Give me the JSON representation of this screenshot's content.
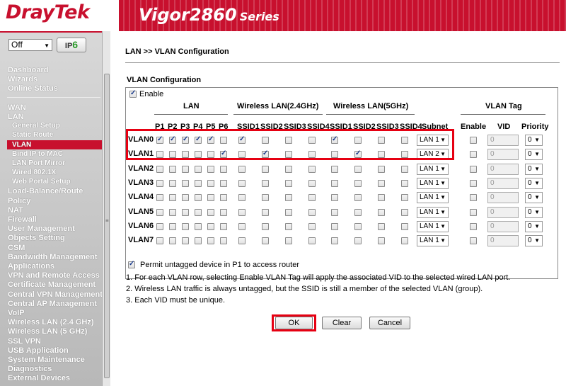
{
  "header": {
    "brand": "DrayTek",
    "model": "Vigor2860",
    "series": "Series"
  },
  "sidebar": {
    "mode_select": "Off",
    "ipv6_label": "IP",
    "ipv6_digit": "6",
    "groups": [
      [
        "Dashboard",
        "Wizards",
        "Online Status"
      ],
      [
        "WAN",
        "LAN"
      ]
    ],
    "lan_sub": [
      "General Setup",
      "Static Route",
      "VLAN",
      "Bind IP to MAC",
      "LAN Port Mirror",
      "Wired 802.1X",
      "Web Portal Setup"
    ],
    "items": [
      "Load-Balance/Route",
      "Policy",
      "NAT",
      "Firewall",
      "User Management",
      "Objects Setting",
      "CSM",
      "Bandwidth Management",
      "Applications",
      "VPN and Remote Access",
      "Certificate Management",
      "Central VPN Management",
      "Central AP Management",
      "VoIP",
      "Wireless LAN (2.4 GHz)",
      "Wireless LAN (5 GHz)",
      "SSL VPN",
      "USB Application",
      "System Maintenance",
      "Diagnostics",
      "External Devices"
    ],
    "active": "VLAN"
  },
  "main": {
    "breadcrumb": "LAN >> VLAN Configuration",
    "section_title": "VLAN Configuration",
    "enable_label": "Enable",
    "enable_checked": true,
    "group_headers": {
      "lan": "LAN",
      "wlan24": "Wireless LAN(2.4GHz)",
      "wlan5": "Wireless LAN(5GHz)",
      "vlan_tag": "VLAN Tag"
    },
    "columns": [
      "P1",
      "P2",
      "P3",
      "P4",
      "P5",
      "P6",
      "SSID1",
      "SSID2",
      "SSID3",
      "SSID4",
      "SSID1",
      "SSID2",
      "SSID3",
      "SSID4"
    ],
    "subnet_header": "Subnet",
    "tag_columns": {
      "enable": "Enable",
      "vid": "VID",
      "priority": "Priority"
    },
    "rows": [
      {
        "name": "VLAN0",
        "checks": [
          1,
          1,
          1,
          1,
          1,
          0,
          1,
          0,
          0,
          0,
          1,
          0,
          0,
          0
        ],
        "subnet": "LAN 1",
        "tag": false,
        "vid": "0",
        "priority": "0"
      },
      {
        "name": "VLAN1",
        "checks": [
          0,
          0,
          0,
          0,
          0,
          1,
          0,
          1,
          0,
          0,
          0,
          1,
          0,
          0
        ],
        "subnet": "LAN 2",
        "tag": false,
        "vid": "0",
        "priority": "0"
      },
      {
        "name": "VLAN2",
        "checks": [
          0,
          0,
          0,
          0,
          0,
          0,
          0,
          0,
          0,
          0,
          0,
          0,
          0,
          0
        ],
        "subnet": "LAN 1",
        "tag": false,
        "vid": "0",
        "priority": "0"
      },
      {
        "name": "VLAN3",
        "checks": [
          0,
          0,
          0,
          0,
          0,
          0,
          0,
          0,
          0,
          0,
          0,
          0,
          0,
          0
        ],
        "subnet": "LAN 1",
        "tag": false,
        "vid": "0",
        "priority": "0"
      },
      {
        "name": "VLAN4",
        "checks": [
          0,
          0,
          0,
          0,
          0,
          0,
          0,
          0,
          0,
          0,
          0,
          0,
          0,
          0
        ],
        "subnet": "LAN 1",
        "tag": false,
        "vid": "0",
        "priority": "0"
      },
      {
        "name": "VLAN5",
        "checks": [
          0,
          0,
          0,
          0,
          0,
          0,
          0,
          0,
          0,
          0,
          0,
          0,
          0,
          0
        ],
        "subnet": "LAN 1",
        "tag": false,
        "vid": "0",
        "priority": "0"
      },
      {
        "name": "VLAN6",
        "checks": [
          0,
          0,
          0,
          0,
          0,
          0,
          0,
          0,
          0,
          0,
          0,
          0,
          0,
          0
        ],
        "subnet": "LAN 1",
        "tag": false,
        "vid": "0",
        "priority": "0"
      },
      {
        "name": "VLAN7",
        "checks": [
          0,
          0,
          0,
          0,
          0,
          0,
          0,
          0,
          0,
          0,
          0,
          0,
          0,
          0
        ],
        "subnet": "LAN 1",
        "tag": false,
        "vid": "0",
        "priority": "0"
      }
    ],
    "permit_label": "Permit untagged device in P1 to access router",
    "permit_checked": true,
    "notes": [
      "1. For each VLAN row, selecting Enable VLAN Tag will apply the associated VID to the selected wired LAN port.",
      "2. Wireless LAN traffic is always untagged, but the SSID is still a member of the selected VLAN (group).",
      "3. Each VID must be unique."
    ],
    "buttons": {
      "ok": "OK",
      "clear": "Clear",
      "cancel": "Cancel"
    },
    "highlight_color": "#e60012"
  }
}
